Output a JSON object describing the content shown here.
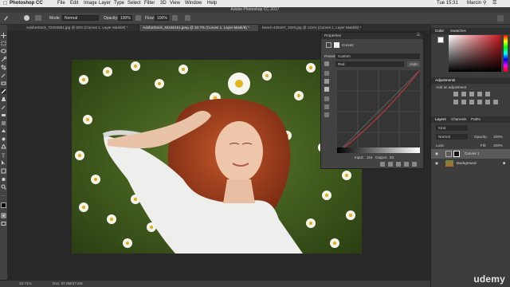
{
  "menubar": {
    "apple_icon": "apple-logo",
    "items": [
      "Photoshop CC",
      "File",
      "Edit",
      "Image",
      "Layer",
      "Type",
      "Select",
      "Filter",
      "3D",
      "View",
      "Window",
      "Help"
    ],
    "clock": "Tue 15:31",
    "user": "Marcin"
  },
  "titlebar": {
    "title": "Adobe Photoshop CC 2017"
  },
  "options": {
    "mode_label": "Mode:",
    "mode_value": "Normal",
    "opacity_label": "Opacity:",
    "opacity_value": "100%",
    "flow_label": "Flow:",
    "flow_value": "100%"
  },
  "tabs": [
    {
      "label": "AdobeStock_72326881.jpg @ 50% (Curves 1, Layer Mask/8) *",
      "active": false
    },
    {
      "label": "AdobeStock_84165151.jpeg @ 33.7% (Curves 1, Layer Mask/8) *",
      "active": true
    },
    {
      "label": "beach-425167_1920.jpg @ 121% (Curves 1, Layer Mask/8) *",
      "active": false
    }
  ],
  "status": {
    "zoom": "33.71%",
    "doc": "Doc: 67.9M/47.5M"
  },
  "properties": {
    "header": "Properties",
    "adjustment_name": "Curves",
    "preset_label": "Preset:",
    "preset_value": "Custom",
    "channel_value": "Red",
    "auto_label": "Auto",
    "input_label": "Input:",
    "input_value": "115",
    "output_label": "Output:",
    "output_value": "93"
  },
  "color_panel": {
    "tab_color": "Color",
    "tab_swatches": "Swatches"
  },
  "adjust_panel": {
    "header": "Adjustments",
    "subtitle": "Add an adjustment"
  },
  "layers_panel": {
    "tab_layers": "Layers",
    "tab_channels": "Channels",
    "tab_paths": "Paths",
    "kind_label": "Kind",
    "blend_mode": "Normal",
    "opacity_label": "Opacity:",
    "opacity_value": "100%",
    "lock_label": "Lock:",
    "fill_label": "Fill:",
    "fill_value": "100%",
    "layers": [
      {
        "name": "Curves 1",
        "selected": true
      },
      {
        "name": "Background",
        "selected": false
      }
    ]
  },
  "watermark": "udemy",
  "colors": {
    "accent": "#2f6fd6",
    "curve_red": "#d23a3a",
    "hue_red": "#c4151c"
  }
}
